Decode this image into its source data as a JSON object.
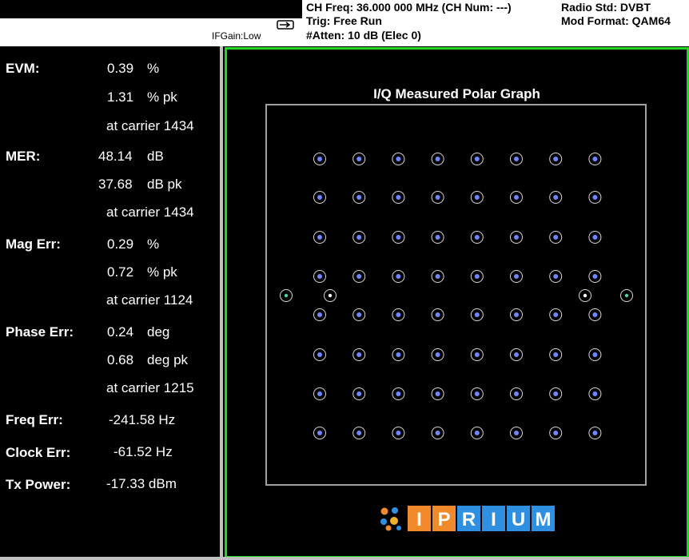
{
  "header": {
    "ifgain": "IFGain:Low",
    "ch_freq": "CH Freq: 36.000 000 MHz (CH Num: ---)",
    "trig": "Trig: Free Run",
    "atten": "#Atten: 10 dB (Elec 0)",
    "radio_std": "Radio Std: DVBT",
    "mod_format": "Mod Format: QAM64"
  },
  "metrics": {
    "evm": {
      "label": "EVM:",
      "rms": "0.39",
      "rms_unit": "%",
      "pk": "1.31",
      "pk_unit": "% pk",
      "carrier": "at carrier 1434"
    },
    "mer": {
      "label": "MER:",
      "rms": "48.14",
      "rms_unit": "dB",
      "pk": "37.68",
      "pk_unit": "dB pk",
      "carrier": "at carrier 1434"
    },
    "mag_err": {
      "label": "Mag Err:",
      "rms": "0.29",
      "rms_unit": "%",
      "pk": "0.72",
      "pk_unit": "% pk",
      "carrier": "at carrier 1124"
    },
    "phase_err": {
      "label": "Phase Err:",
      "rms": "0.24",
      "rms_unit": "deg",
      "pk": "0.68",
      "pk_unit": "deg pk",
      "carrier": "at carrier 1215"
    },
    "freq_err": {
      "label": "Freq Err:",
      "value": "-241.58 Hz"
    },
    "clock_err": {
      "label": "Clock Err:",
      "value": "-61.52 Hz"
    },
    "tx_power": {
      "label": "Tx Power:",
      "value": "-17.33 dBm"
    }
  },
  "plot": {
    "title": "I/Q Measured Polar Graph",
    "constellation": {
      "grid_size": 8,
      "ring_color": "#d8d8d8",
      "dot_color": "#6f86ff",
      "pilot_white_color": "#ffffff",
      "pilot_green_color": "#43d9a0"
    },
    "frame_color": "#1fd81f",
    "box_color": "#a0a0a0"
  },
  "logo": {
    "letters": [
      "I",
      "P",
      "R",
      "I",
      "U",
      "M"
    ],
    "letter_colors": [
      "#f08a2a",
      "#f08a2a",
      "#2f8fe0",
      "#2f8fe0",
      "#2f8fe0",
      "#2f8fe0"
    ]
  }
}
